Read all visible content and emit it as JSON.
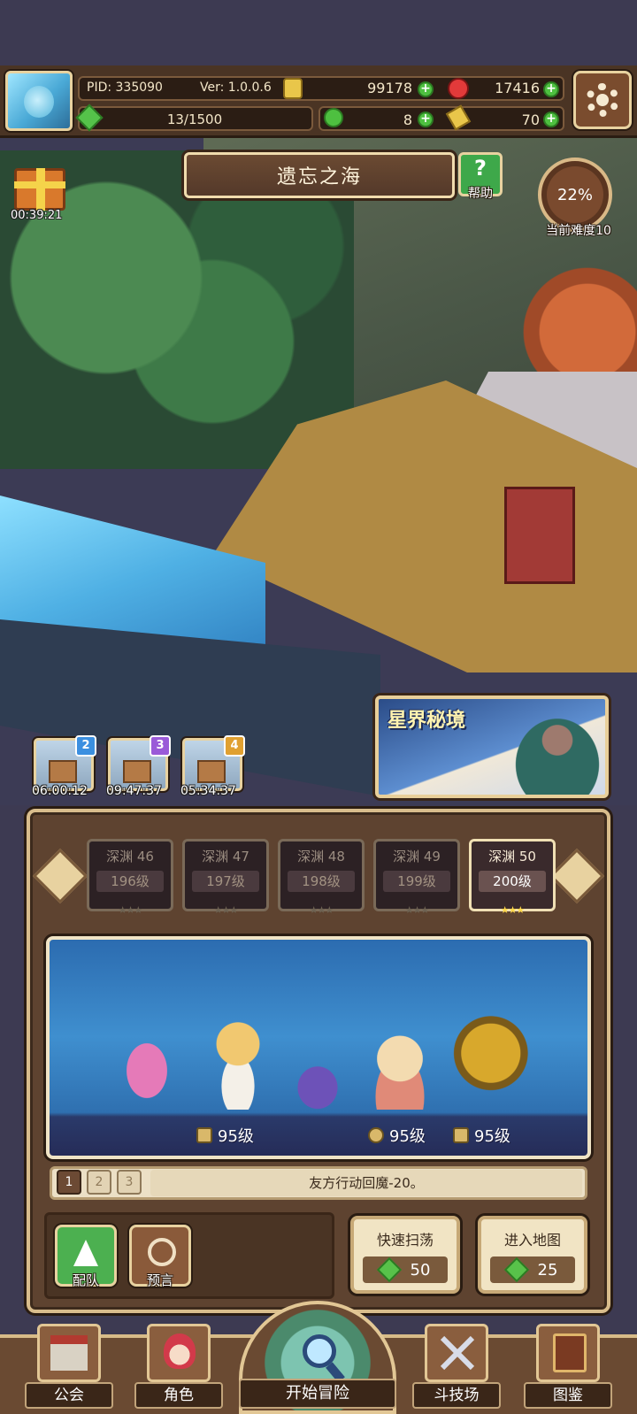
{
  "topbar": {
    "pid": "PID: 335090",
    "version": "Ver: 1.0.0.6",
    "energy": "13/1500",
    "gold": "99178",
    "ruby": "17416",
    "clover": "8",
    "key": "70"
  },
  "header": {
    "title": "遗忘之海",
    "help_label": "帮助",
    "difficulty_percent": "22%",
    "difficulty_label": "当前难度10",
    "gift_timer": "00:39:21"
  },
  "realm_banner": {
    "title": "星界秘境"
  },
  "chests": [
    {
      "level": "2",
      "timer": "06:00:12",
      "color": "#3b8fe0"
    },
    {
      "level": "3",
      "timer": "09:47:37",
      "color": "#9a5ad8"
    },
    {
      "level": "4",
      "timer": "05:34:37",
      "color": "#e0a030"
    }
  ],
  "stages": [
    {
      "name": "深渊 46",
      "level": "196级",
      "active": false
    },
    {
      "name": "深渊 47",
      "level": "197级",
      "active": false
    },
    {
      "name": "深渊 48",
      "level": "198级",
      "active": false
    },
    {
      "name": "深渊 49",
      "level": "199级",
      "active": false
    },
    {
      "name": "深渊 50",
      "level": "200级",
      "active": true
    }
  ],
  "enemy_levels": [
    "95级",
    "95级",
    "95级"
  ],
  "team_pages": [
    "1",
    "2",
    "3"
  ],
  "effect_text": "友方行动回魔-20。",
  "buttons": {
    "formation": "配队",
    "prophecy": "预言",
    "quick_sweep": "快速扫荡",
    "quick_sweep_cost": "50",
    "enter_map": "进入地图",
    "enter_map_cost": "25"
  },
  "nav": {
    "guild": "公会",
    "character": "角色",
    "adventure": "开始冒险",
    "arena": "斗技场",
    "codex": "图鉴"
  }
}
